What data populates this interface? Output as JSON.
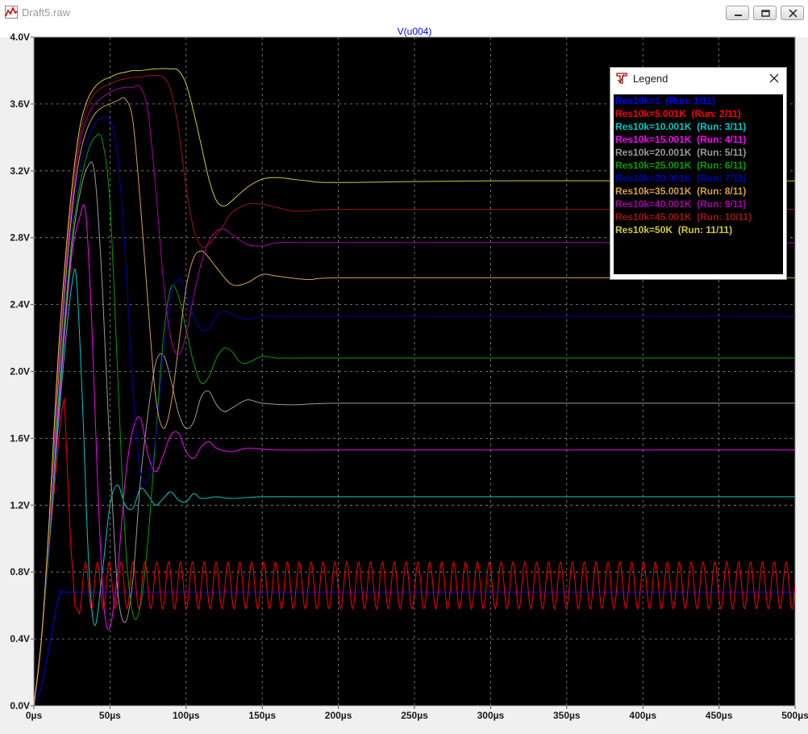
{
  "window": {
    "title": "Draft5.raw"
  },
  "plot": {
    "trace_label": "V(u004)"
  },
  "legend": {
    "title": "Legend",
    "entries": [
      {
        "label": "Res10k=1  (Run: 1/11)",
        "color": "#0000ff"
      },
      {
        "label": "Res10k=5.001K  (Run: 2/11)",
        "color": "#ff0000"
      },
      {
        "label": "Res10k=10.001K  (Run: 3/11)",
        "color": "#00c8c8"
      },
      {
        "label": "Res10k=15.001K  (Run: 4/11)",
        "color": "#ff00ff"
      },
      {
        "label": "Res10k=20.001K  (Run: 5/11)",
        "color": "#9a9a9a"
      },
      {
        "label": "Res10k=25.001K  (Run: 6/11)",
        "color": "#00a000"
      },
      {
        "label": "Res10k=30.001K  (Run: 7/11)",
        "color": "#0000b4"
      },
      {
        "label": "Res10k=35.001K  (Run: 8/11)",
        "color": "#d2a050"
      },
      {
        "label": "Res10k=40.001K  (Run: 9/11)",
        "color": "#aa00aa"
      },
      {
        "label": "Res10k=45.001K  (Run: 10/11)",
        "color": "#a01414"
      },
      {
        "label": "Res10k=50K  (Run: 11/11)",
        "color": "#d2c83c"
      }
    ]
  },
  "chart_data": {
    "type": "line",
    "title": "V(u004)",
    "xlabel": "",
    "ylabel": "",
    "xlim": [
      0,
      500
    ],
    "ylim": [
      0,
      4.0
    ],
    "x_unit": "µs",
    "y_unit": "V",
    "x_ticks": [
      "0µs",
      "50µs",
      "100µs",
      "150µs",
      "200µs",
      "250µs",
      "300µs",
      "350µs",
      "400µs",
      "450µs",
      "500µs"
    ],
    "y_ticks": [
      "0.0V",
      "0.4V",
      "0.8V",
      "1.2V",
      "1.6V",
      "2.0V",
      "2.4V",
      "2.8V",
      "3.2V",
      "3.6V",
      "4.0V"
    ],
    "grid": true,
    "legend_position": "top-right",
    "series": [
      {
        "name": "Res10k=1  (Run: 1/11)",
        "color": "#0000ff",
        "x": [
          0,
          5,
          10,
          15,
          18,
          20,
          50,
          100,
          200,
          300,
          400,
          500
        ],
        "y": [
          0,
          0.12,
          0.35,
          0.6,
          0.68,
          0.68,
          0.68,
          0.68,
          0.68,
          0.68,
          0.68,
          0.68
        ]
      },
      {
        "name": "Res10k=5.001K  (Run: 2/11)",
        "color": "#ff0000",
        "x": [
          0,
          5,
          10,
          15,
          18,
          20,
          24,
          27,
          30,
          500
        ],
        "y": [
          0,
          0.4,
          0.95,
          1.45,
          1.75,
          1.84,
          1.0,
          0.6,
          0.55,
          0.72
        ],
        "osc_from": 30,
        "osc_center": 0.72,
        "osc_amp": 0.14,
        "osc_period": 7.8
      },
      {
        "name": "Res10k=10.001K  (Run: 3/11)",
        "color": "#00c8c8",
        "x": [
          0,
          5,
          10,
          15,
          20,
          25,
          28,
          32,
          36,
          40,
          45,
          50,
          55,
          60,
          65,
          70,
          75,
          80,
          85,
          90,
          95,
          100,
          105,
          110,
          120,
          130,
          150,
          200,
          300,
          500
        ],
        "y": [
          0,
          0.4,
          0.95,
          1.55,
          2.1,
          2.52,
          2.55,
          1.8,
          0.85,
          0.48,
          0.8,
          1.2,
          1.32,
          1.2,
          1.18,
          1.3,
          1.26,
          1.2,
          1.24,
          1.28,
          1.23,
          1.22,
          1.27,
          1.24,
          1.25,
          1.24,
          1.25,
          1.25,
          1.25,
          1.25
        ]
      },
      {
        "name": "Res10k=15.001K  (Run: 4/11)",
        "color": "#ff00ff",
        "x": [
          0,
          5,
          10,
          15,
          20,
          25,
          30,
          34,
          38,
          42,
          46,
          50,
          55,
          60,
          65,
          70,
          75,
          80,
          85,
          90,
          95,
          100,
          105,
          110,
          115,
          120,
          130,
          140,
          160,
          200,
          300,
          500
        ],
        "y": [
          0,
          0.4,
          1.0,
          1.6,
          2.2,
          2.7,
          2.92,
          2.95,
          2.3,
          1.3,
          0.6,
          0.47,
          0.8,
          1.35,
          1.65,
          1.72,
          1.5,
          1.4,
          1.5,
          1.62,
          1.63,
          1.52,
          1.48,
          1.55,
          1.58,
          1.54,
          1.52,
          1.54,
          1.53,
          1.53,
          1.53,
          1.53
        ]
      },
      {
        "name": "Res10k=20.001K  (Run: 5/11)",
        "color": "#9a9a9a",
        "x": [
          0,
          5,
          10,
          15,
          20,
          25,
          30,
          35,
          40,
          45,
          50,
          55,
          60,
          65,
          70,
          75,
          80,
          85,
          90,
          95,
          100,
          105,
          110,
          115,
          120,
          125,
          130,
          140,
          150,
          170,
          200,
          300,
          500
        ],
        "y": [
          0,
          0.4,
          1.0,
          1.65,
          2.25,
          2.75,
          3.05,
          3.22,
          3.18,
          2.5,
          1.5,
          0.7,
          0.5,
          0.75,
          1.35,
          1.75,
          2.05,
          2.1,
          1.95,
          1.75,
          1.66,
          1.7,
          1.85,
          1.88,
          1.8,
          1.76,
          1.78,
          1.83,
          1.81,
          1.8,
          1.81,
          1.81,
          1.81
        ]
      },
      {
        "name": "Res10k=25.001K  (Run: 6/11)",
        "color": "#00a000",
        "x": [
          0,
          5,
          10,
          15,
          20,
          25,
          30,
          35,
          40,
          45,
          50,
          55,
          60,
          65,
          70,
          75,
          80,
          85,
          90,
          95,
          100,
          105,
          110,
          115,
          120,
          125,
          130,
          135,
          140,
          150,
          160,
          180,
          200,
          300,
          500
        ],
        "y": [
          0,
          0.4,
          1.0,
          1.7,
          2.3,
          2.8,
          3.1,
          3.3,
          3.4,
          3.38,
          3.0,
          2.0,
          1.0,
          0.55,
          0.6,
          1.0,
          1.6,
          2.2,
          2.5,
          2.45,
          2.25,
          2.05,
          1.93,
          1.97,
          2.08,
          2.14,
          2.12,
          2.06,
          2.05,
          2.09,
          2.08,
          2.08,
          2.08,
          2.08,
          2.08
        ]
      },
      {
        "name": "Res10k=30.001K  (Run: 7/11)",
        "color": "#0000b4",
        "x": [
          0,
          5,
          10,
          15,
          20,
          25,
          30,
          35,
          40,
          45,
          50,
          55,
          60,
          65,
          70,
          75,
          80,
          85,
          90,
          95,
          100,
          105,
          110,
          115,
          120,
          125,
          130,
          140,
          150,
          160,
          180,
          200,
          300,
          500
        ],
        "y": [
          0,
          0.4,
          1.0,
          1.75,
          2.4,
          2.9,
          3.2,
          3.38,
          3.48,
          3.52,
          3.5,
          3.3,
          2.7,
          1.9,
          1.4,
          1.35,
          1.6,
          2.1,
          2.45,
          2.55,
          2.48,
          2.33,
          2.25,
          2.26,
          2.33,
          2.36,
          2.34,
          2.31,
          2.33,
          2.33,
          2.33,
          2.33,
          2.33,
          2.33
        ]
      },
      {
        "name": "Res10k=35.001K  (Run: 8/11)",
        "color": "#d2a050",
        "x": [
          0,
          5,
          10,
          15,
          20,
          25,
          30,
          35,
          40,
          45,
          50,
          55,
          60,
          65,
          70,
          75,
          80,
          85,
          90,
          95,
          100,
          105,
          110,
          115,
          120,
          130,
          140,
          150,
          160,
          180,
          200,
          300,
          500
        ],
        "y": [
          0,
          0.4,
          1.05,
          1.8,
          2.45,
          2.95,
          3.28,
          3.45,
          3.54,
          3.58,
          3.6,
          3.62,
          3.63,
          3.5,
          3.0,
          2.4,
          1.85,
          1.66,
          1.8,
          2.15,
          2.5,
          2.68,
          2.72,
          2.68,
          2.62,
          2.52,
          2.53,
          2.58,
          2.57,
          2.55,
          2.56,
          2.56,
          2.56
        ]
      },
      {
        "name": "Res10k=40.001K  (Run: 9/11)",
        "color": "#aa00aa",
        "x": [
          0,
          5,
          10,
          15,
          20,
          25,
          30,
          35,
          40,
          45,
          50,
          55,
          60,
          65,
          70,
          75,
          80,
          85,
          90,
          95,
          100,
          105,
          110,
          115,
          120,
          125,
          130,
          140,
          150,
          160,
          180,
          200,
          300,
          500
        ],
        "y": [
          0,
          0.4,
          1.05,
          1.85,
          2.5,
          3.0,
          3.35,
          3.52,
          3.6,
          3.64,
          3.67,
          3.69,
          3.7,
          3.7,
          3.7,
          3.55,
          3.1,
          2.55,
          2.2,
          2.1,
          2.22,
          2.45,
          2.65,
          2.78,
          2.84,
          2.85,
          2.82,
          2.76,
          2.75,
          2.77,
          2.77,
          2.77,
          2.77,
          2.77
        ]
      },
      {
        "name": "Res10k=45.001K  (Run: 10/11)",
        "color": "#a01414",
        "x": [
          0,
          5,
          10,
          15,
          20,
          25,
          30,
          35,
          40,
          45,
          50,
          55,
          60,
          65,
          70,
          75,
          80,
          85,
          90,
          95,
          100,
          105,
          110,
          115,
          120,
          125,
          130,
          140,
          150,
          160,
          170,
          180,
          200,
          300,
          500
        ],
        "y": [
          0,
          0.4,
          1.05,
          1.9,
          2.55,
          3.05,
          3.4,
          3.58,
          3.66,
          3.7,
          3.72,
          3.74,
          3.75,
          3.76,
          3.76,
          3.77,
          3.77,
          3.76,
          3.68,
          3.45,
          3.1,
          2.85,
          2.75,
          2.76,
          2.82,
          2.88,
          2.95,
          3.0,
          3.0,
          2.98,
          2.96,
          2.96,
          2.97,
          2.97,
          2.97
        ]
      },
      {
        "name": "Res10k=50K  (Run: 11/11)",
        "color": "#d2c83c",
        "x": [
          0,
          5,
          10,
          15,
          20,
          25,
          30,
          35,
          40,
          45,
          50,
          55,
          60,
          65,
          70,
          80,
          90,
          95,
          100,
          105,
          110,
          115,
          120,
          125,
          130,
          140,
          150,
          160,
          170,
          180,
          200,
          300,
          500
        ],
        "y": [
          0,
          0.4,
          1.1,
          1.95,
          2.6,
          3.1,
          3.45,
          3.62,
          3.7,
          3.74,
          3.76,
          3.78,
          3.79,
          3.8,
          3.8,
          3.81,
          3.81,
          3.8,
          3.72,
          3.55,
          3.35,
          3.15,
          3.02,
          2.99,
          3.02,
          3.1,
          3.15,
          3.16,
          3.15,
          3.14,
          3.13,
          3.14,
          3.14
        ]
      }
    ]
  }
}
